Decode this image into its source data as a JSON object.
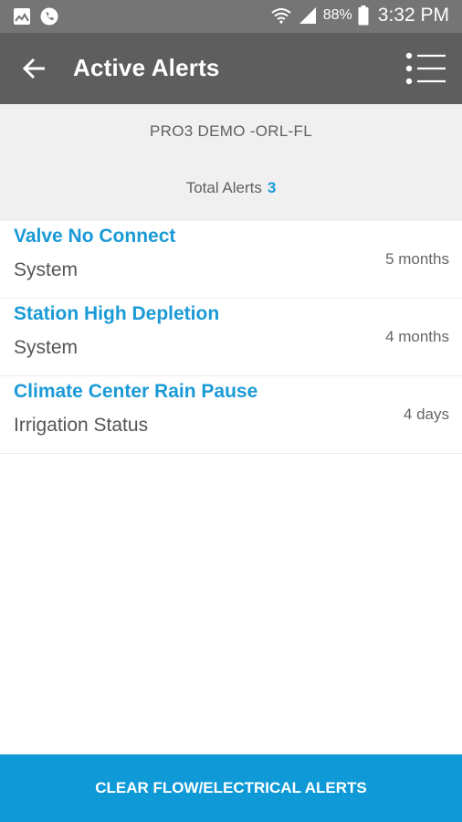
{
  "status_bar": {
    "battery": "88%",
    "time": "3:32 PM",
    "icons": [
      "gallery-icon",
      "phone-icon",
      "wifi-icon",
      "signal-icon",
      "battery-icon"
    ]
  },
  "app_bar": {
    "title": "Active Alerts",
    "icons": [
      "back-arrow-icon",
      "list-menu-icon"
    ]
  },
  "summary": {
    "site_name": "PRO3 DEMO -ORL-FL",
    "total_label": "Total Alerts",
    "total_count": "3"
  },
  "alerts": [
    {
      "title": "Valve No Connect",
      "category": "System",
      "age": "5 months"
    },
    {
      "title": "Station High Depletion",
      "category": "System",
      "age": "4 months"
    },
    {
      "title": "Climate Center Rain Pause",
      "category": "Irrigation Status",
      "age": "4 days"
    }
  ],
  "footer": {
    "button_label": "CLEAR FLOW/ELECTRICAL ALERTS"
  },
  "colors": {
    "accent": "#1a9ad6",
    "button": "#0f9ad7",
    "app_bar": "#5e5e5e",
    "status_bar": "#757575",
    "summary_bg": "#f0f0f0"
  }
}
